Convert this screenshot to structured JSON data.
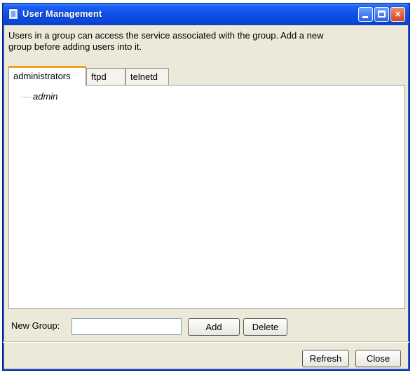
{
  "window": {
    "title": "User Management",
    "controls": {
      "minimize": "minimize",
      "maximize": "maximize",
      "close": "×"
    }
  },
  "description_line1": "Users in a group can access the service associated with the group. Add a new",
  "description_line2": "group before adding users into it.",
  "tabs": [
    {
      "label": "administrators",
      "active": true
    },
    {
      "label": "ftpd",
      "active": false
    },
    {
      "label": "telnetd",
      "active": false
    }
  ],
  "tree": {
    "items": [
      "admin"
    ]
  },
  "form": {
    "new_group_label": "New Group:",
    "new_group_value": "",
    "add_label": "Add",
    "delete_label": "Delete"
  },
  "footer": {
    "refresh_label": "Refresh",
    "close_label": "Close"
  },
  "icons": [
    "app-icon",
    "minimize-icon",
    "maximize-icon",
    "close-icon"
  ],
  "colors": {
    "titlebar": "#0d4ee6",
    "window_bg": "#ece9d8",
    "active_tab_accent": "#f0a020",
    "close_button": "#d5431f"
  }
}
